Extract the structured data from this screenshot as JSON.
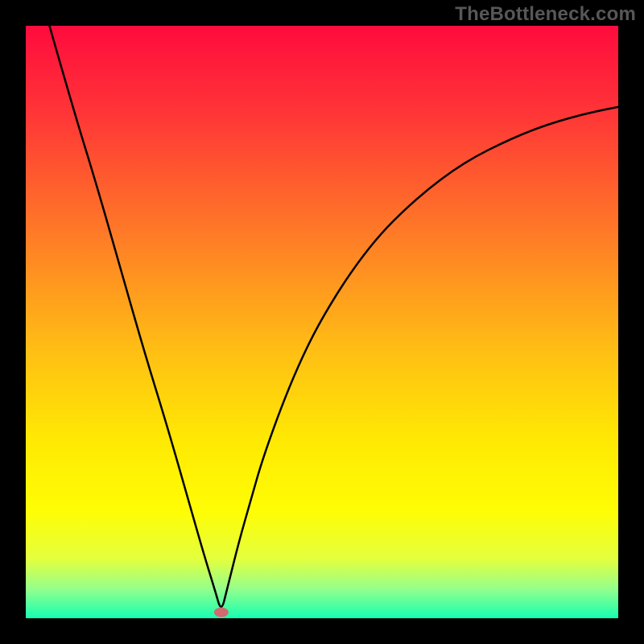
{
  "watermark": "TheBottleneck.com",
  "chart_data": {
    "type": "line",
    "title": "",
    "xlabel": "",
    "ylabel": "",
    "xlim": [
      0,
      100
    ],
    "ylim": [
      0,
      100
    ],
    "grid": false,
    "legend": false,
    "annotations": [],
    "background_gradient_stops": [
      {
        "offset": 0.0,
        "color": "#ff0b3d"
      },
      {
        "offset": 0.15,
        "color": "#ff3637"
      },
      {
        "offset": 0.35,
        "color": "#ff7a27"
      },
      {
        "offset": 0.55,
        "color": "#ffbf14"
      },
      {
        "offset": 0.7,
        "color": "#ffe903"
      },
      {
        "offset": 0.82,
        "color": "#fffd05"
      },
      {
        "offset": 0.9,
        "color": "#e3ff3e"
      },
      {
        "offset": 0.95,
        "color": "#95ff8c"
      },
      {
        "offset": 1.0,
        "color": "#15ffb1"
      }
    ],
    "marker": {
      "x": 33,
      "y": 1.0,
      "color": "#cf6b6e"
    },
    "series": [
      {
        "name": "curve",
        "color": "#000000",
        "x": [
          4,
          8,
          12,
          16,
          20,
          24,
          28,
          30,
          32,
          33,
          34,
          36,
          38,
          40,
          44,
          48,
          52,
          56,
          60,
          64,
          68,
          72,
          76,
          80,
          84,
          88,
          92,
          96,
          100
        ],
        "values": [
          100,
          86,
          73,
          59,
          45,
          32,
          18,
          11,
          4.5,
          1.0,
          5,
          13,
          20,
          27,
          38,
          47,
          54,
          60,
          65,
          69,
          72.5,
          75.5,
          78,
          80,
          81.8,
          83.3,
          84.5,
          85.5,
          86.3
        ]
      }
    ]
  }
}
